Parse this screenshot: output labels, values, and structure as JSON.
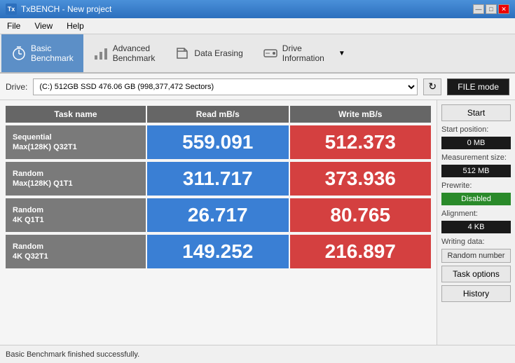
{
  "titleBar": {
    "title": "TxBENCH - New project",
    "controls": [
      "—",
      "□",
      "✕"
    ]
  },
  "menuBar": {
    "items": [
      "File",
      "View",
      "Help"
    ]
  },
  "toolbar": {
    "tabs": [
      {
        "id": "basic",
        "icon": "⏱",
        "label": "Basic\nBenchmark",
        "active": true
      },
      {
        "id": "advanced",
        "icon": "📊",
        "label": "Advanced\nBenchmark",
        "active": false
      },
      {
        "id": "erase",
        "icon": "🗑",
        "label": "Data Erasing",
        "active": false
      },
      {
        "id": "drive",
        "icon": "💾",
        "label": "Drive\nInformation",
        "active": false
      }
    ]
  },
  "drivebar": {
    "label": "Drive:",
    "value": "(C:) 512GB SSD  476.06 GB (998,377,472 Sectors)",
    "fileModeLabel": "FILE mode"
  },
  "tableHeader": {
    "col1": "Task name",
    "col2": "Read mB/s",
    "col3": "Write mB/s"
  },
  "rows": [
    {
      "label": "Sequential\nMax(128K) Q32T1",
      "read": "559.091",
      "write": "512.373"
    },
    {
      "label": "Random\nMax(128K) Q1T1",
      "read": "311.717",
      "write": "373.936"
    },
    {
      "label": "Random\n4K Q1T1",
      "read": "26.717",
      "write": "80.765"
    },
    {
      "label": "Random\n4K Q32T1",
      "read": "149.252",
      "write": "216.897"
    }
  ],
  "sidePanel": {
    "startLabel": "Start",
    "startPositionLabel": "Start position:",
    "startPositionValue": "0 MB",
    "measurementSizeLabel": "Measurement size:",
    "measurementSizeValue": "512 MB",
    "prewriteLabel": "Prewrite:",
    "prewriteValue": "Disabled",
    "alignmentLabel": "Alignment:",
    "alignmentValue": "4 KB",
    "writingDataLabel": "Writing data:",
    "writingDataValue": "Random number",
    "taskOptionsLabel": "Task options",
    "historyLabel": "History"
  },
  "statusBar": {
    "text": "Basic Benchmark finished successfully."
  }
}
